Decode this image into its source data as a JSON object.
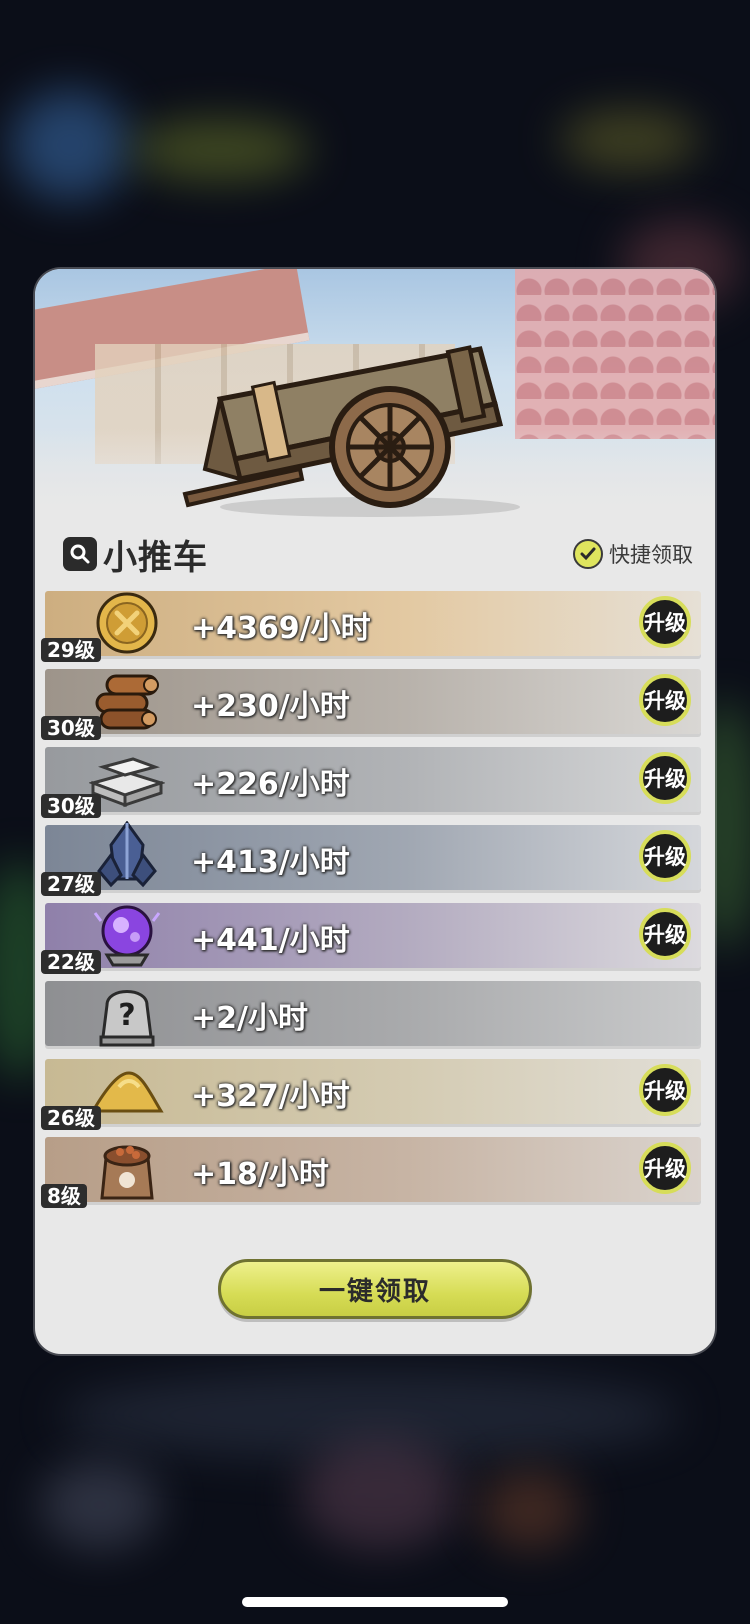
{
  "panel": {
    "title": "小推车",
    "quick_claim_label": "快捷领取",
    "collect_all_label": "一键领取"
  },
  "rows": [
    {
      "icon": "gold-coin-icon",
      "level": "29级",
      "rate": "+4369/小时",
      "upgrade": "升级",
      "color": "#d7b98e"
    },
    {
      "icon": "wood-logs-icon",
      "level": "30级",
      "rate": "+230/小时",
      "upgrade": "升级",
      "color": "#a9a49d"
    },
    {
      "icon": "stone-blocks-icon",
      "level": "30级",
      "rate": "+226/小时",
      "upgrade": "升级",
      "color": "#a4a6a9"
    },
    {
      "icon": "crystal-ore-icon",
      "level": "27级",
      "rate": "+413/小时",
      "upgrade": "升级",
      "color": "#8d96a4"
    },
    {
      "icon": "magic-orb-icon",
      "level": "22级",
      "rate": "+441/小时",
      "upgrade": "升级",
      "color": "#a99fb4"
    },
    {
      "icon": "unknown-helmet-icon",
      "level": "",
      "rate": "+2/小时",
      "upgrade": "",
      "color": "#a6a7a9"
    },
    {
      "icon": "sand-pile-icon",
      "level": "26级",
      "rate": "+327/小时",
      "upgrade": "升级",
      "color": "#cdc1a2"
    },
    {
      "icon": "seed-bag-icon",
      "level": "8级",
      "rate": "+18/小时",
      "upgrade": "升级",
      "color": "#c2a995"
    }
  ],
  "colors": {
    "accent": "#d7dd5a",
    "dark": "#2d2d2d"
  }
}
